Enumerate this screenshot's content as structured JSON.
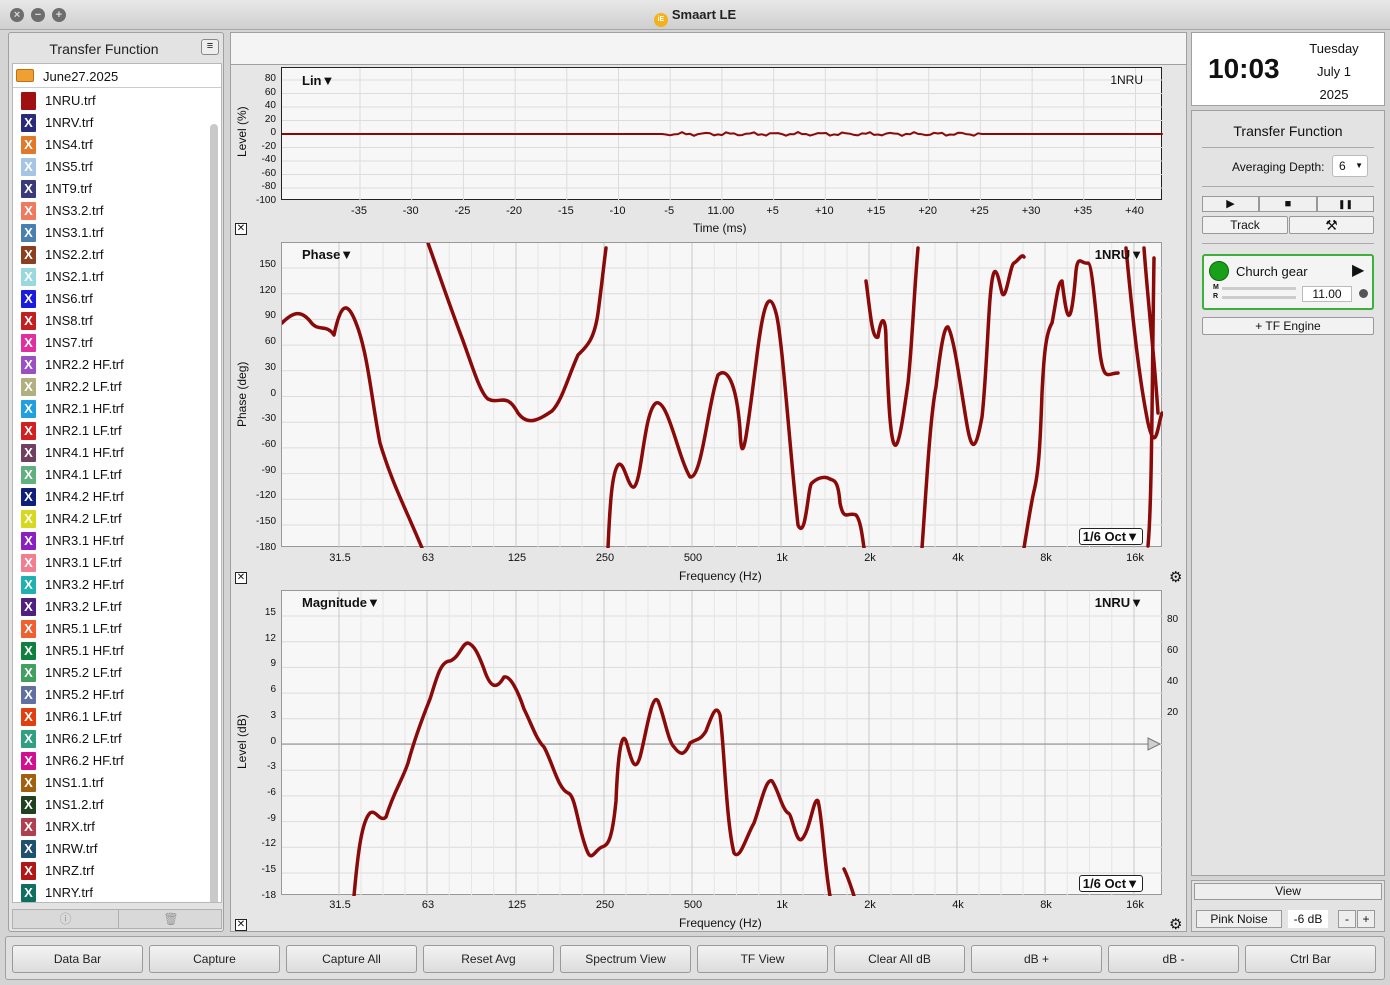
{
  "window": {
    "title": "Smaart LE",
    "logo_text": "iE"
  },
  "left_panel": {
    "title": "Transfer Function",
    "folder": "June27.2025",
    "files": [
      {
        "name": "1NRU.trf",
        "color": "#a01010",
        "mark": ""
      },
      {
        "name": "1NRV.trf",
        "color": "#2a2a7a",
        "mark": "X"
      },
      {
        "name": "1NS4.trf",
        "color": "#e07a2a",
        "mark": "X"
      },
      {
        "name": "1NS5.trf",
        "color": "#a6c4e4",
        "mark": "X"
      },
      {
        "name": "1NT9.trf",
        "color": "#3a3a7a",
        "mark": "X"
      },
      {
        "name": "1NS3.2.trf",
        "color": "#f07a60",
        "mark": "X"
      },
      {
        "name": "1NS3.1.trf",
        "color": "#4a80b0",
        "mark": "X"
      },
      {
        "name": "1NS2.2.trf",
        "color": "#8a4020",
        "mark": "X"
      },
      {
        "name": "1NS2.1.trf",
        "color": "#9ad8e0",
        "mark": "X"
      },
      {
        "name": "1NS6.trf",
        "color": "#1a1ae0",
        "mark": "X"
      },
      {
        "name": "1NS8.trf",
        "color": "#c02020",
        "mark": "X"
      },
      {
        "name": "1NS7.trf",
        "color": "#e030a0",
        "mark": "X"
      },
      {
        "name": "1NR2.2 HF.trf",
        "color": "#9a50c0",
        "mark": "X"
      },
      {
        "name": "1NR2.2 LF.trf",
        "color": "#b0b080",
        "mark": "X"
      },
      {
        "name": "1NR2.1 HF.trf",
        "color": "#20a0e0",
        "mark": "X"
      },
      {
        "name": "1NR2.1 LF.trf",
        "color": "#d02020",
        "mark": "X"
      },
      {
        "name": "1NR4.1 HF.trf",
        "color": "#704060",
        "mark": "X"
      },
      {
        "name": "1NR4.1 LF.trf",
        "color": "#60b080",
        "mark": "X"
      },
      {
        "name": "1NR4.2 HF.trf",
        "color": "#10207a",
        "mark": "X"
      },
      {
        "name": "1NR4.2 LF.trf",
        "color": "#d8d820",
        "mark": "X"
      },
      {
        "name": "1NR3.1 HF.trf",
        "color": "#8a20c0",
        "mark": "X"
      },
      {
        "name": "1NR3.1 LF.trf",
        "color": "#f08090",
        "mark": "X"
      },
      {
        "name": "1NR3.2 HF.trf",
        "color": "#20b0b0",
        "mark": "X"
      },
      {
        "name": "1NR3.2 LF.trf",
        "color": "#502080",
        "mark": "X"
      },
      {
        "name": "1NR5.1 LF.trf",
        "color": "#f06030",
        "mark": "X"
      },
      {
        "name": "1NR5.1 HF.trf",
        "color": "#108040",
        "mark": "X"
      },
      {
        "name": "1NR5.2 LF.trf",
        "color": "#40a060",
        "mark": "X"
      },
      {
        "name": "1NR5.2 HF.trf",
        "color": "#6070a0",
        "mark": "X"
      },
      {
        "name": "1NR6.1 LF.trf",
        "color": "#e04010",
        "mark": "X"
      },
      {
        "name": "1NR6.2 LF.trf",
        "color": "#30a080",
        "mark": "X"
      },
      {
        "name": "1NR6.2 HF.trf",
        "color": "#d01090",
        "mark": "X"
      },
      {
        "name": "1NS1.1.trf",
        "color": "#a06010",
        "mark": "X"
      },
      {
        "name": "1NS1.2.trf",
        "color": "#204020",
        "mark": "X"
      },
      {
        "name": "1NRX.trf",
        "color": "#b04050",
        "mark": "X"
      },
      {
        "name": "1NRW.trf",
        "color": "#205070",
        "mark": "X"
      },
      {
        "name": "1NRZ.trf",
        "color": "#b01818",
        "mark": "X"
      },
      {
        "name": "1NRY.trf",
        "color": "#107060",
        "mark": "X"
      }
    ],
    "info_glyph": "ⓘ",
    "trash_glyph": "🗑"
  },
  "lin_plot": {
    "label": "Lin▼",
    "trace": "1NRU",
    "ylabel": "Level (%)",
    "xlabel": "Time (ms)",
    "yticks": [
      "80",
      "60",
      "40",
      "20",
      "0",
      "-20",
      "-40",
      "-60",
      "-80",
      "-100"
    ],
    "xticks": [
      "-35",
      "-30",
      "-25",
      "-20",
      "-15",
      "-10",
      "-5",
      "11.00",
      "+5",
      "+10",
      "+15",
      "+20",
      "+25",
      "+30",
      "+35",
      "+40"
    ]
  },
  "phase_plot": {
    "label": "Phase▼",
    "trace": "1NRU▼",
    "ylabel": "Phase (deg)",
    "xlabel": "Frequency (Hz)",
    "smoothing": "1/6 Oct▼",
    "yticks": [
      "150",
      "120",
      "90",
      "60",
      "30",
      "0",
      "-30",
      "-60",
      "-90",
      "-120",
      "-150",
      "-180"
    ],
    "xticks": [
      "31.5",
      "63",
      "125",
      "250",
      "500",
      "1k",
      "2k",
      "4k",
      "8k",
      "16k"
    ]
  },
  "mag_plot": {
    "label": "Magnitude▼",
    "trace": "1NRU▼",
    "ylabel": "Level (dB)",
    "xlabel": "Frequency (Hz)",
    "smoothing": "1/6 Oct▼",
    "yticks": [
      "15",
      "12",
      "9",
      "6",
      "3",
      "0",
      "-3",
      "-6",
      "-9",
      "-12",
      "-15",
      "-18"
    ],
    "yticks_right": [
      "80",
      "60",
      "40",
      "20"
    ],
    "xticks": [
      "31.5",
      "63",
      "125",
      "250",
      "500",
      "1k",
      "2k",
      "4k",
      "8k",
      "16k"
    ]
  },
  "clock": {
    "time": "10:03",
    "weekday": "Tuesday",
    "date": "July 1",
    "year": "2025"
  },
  "right_panel": {
    "title": "Transfer Function",
    "averaging_label": "Averaging Depth:",
    "averaging_value": "6",
    "play": "▶",
    "stop": "■",
    "pause": "❚❚",
    "track_label": "Track",
    "tools_glyph": "⚒",
    "engine": {
      "name": "Church gear",
      "delay": "11.00",
      "m_label": "M",
      "r_label": "R"
    },
    "add_engine_label": "+ TF Engine"
  },
  "view_box": {
    "view_label": "View",
    "pink_noise_label": "Pink Noise",
    "level": "-6 dB",
    "minus": "-",
    "plus": "+"
  },
  "bottom_bar": [
    "Data Bar",
    "Capture",
    "Capture All",
    "Reset Avg",
    "Spectrum View",
    "TF View",
    "Clear All dB",
    "dB +",
    "dB -",
    "Ctrl Bar"
  ],
  "colors": {
    "trace": "#8a0a0a",
    "engine_active": "#18a018"
  }
}
